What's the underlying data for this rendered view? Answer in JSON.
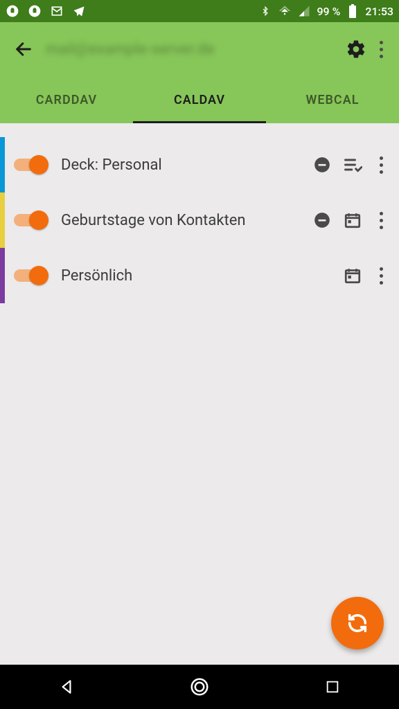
{
  "status": {
    "battery_text": "99 %",
    "time": "21:53"
  },
  "appbar": {
    "title_hidden": "mail@example-server.de"
  },
  "tabs": {
    "items": [
      {
        "label": "CARDDAV"
      },
      {
        "label": "CALDAV"
      },
      {
        "label": "WEBCAL"
      }
    ],
    "active_index": 1
  },
  "calendars": [
    {
      "color": "#0997d6",
      "enabled": true,
      "name": "Deck: Personal",
      "show_readonly": true,
      "trailing_icon": "task-list",
      "show_calendar_icon": false
    },
    {
      "color": "#e7cf3f",
      "enabled": true,
      "name": "Geburtstage von Kontakten",
      "show_readonly": true,
      "trailing_icon": "calendar",
      "show_calendar_icon": true
    },
    {
      "color": "#7c3b9e",
      "enabled": true,
      "name": "Persönlich",
      "show_readonly": false,
      "trailing_icon": "calendar",
      "show_calendar_icon": true
    }
  ],
  "colors": {
    "accent": "#f26c0d",
    "primary": "#87c659",
    "primary_dark": "#3e7d1a"
  }
}
